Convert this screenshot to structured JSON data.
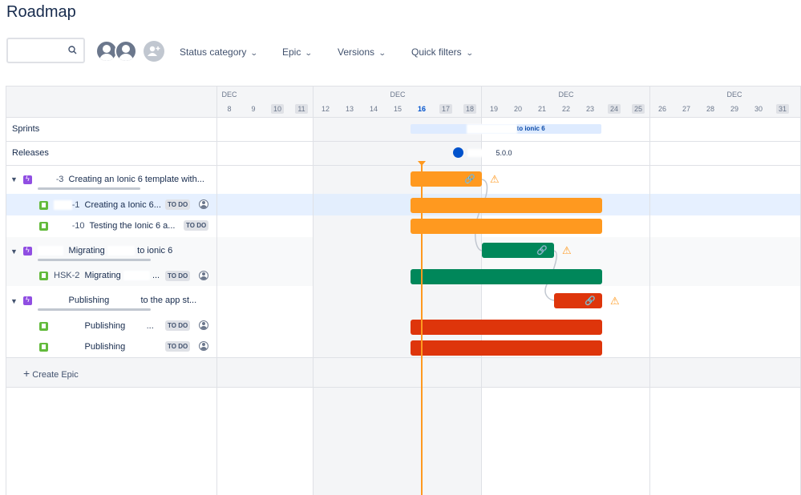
{
  "page": {
    "title": "Roadmap"
  },
  "toolbar": {
    "search_placeholder": "",
    "filters": [
      "Status category",
      "Epic",
      "Versions",
      "Quick filters"
    ]
  },
  "timeline": {
    "months": [
      "DEC",
      "DEC",
      "DEC",
      "DEC"
    ],
    "days": [
      "8",
      "9",
      "10",
      "11",
      "12",
      "13",
      "14",
      "15",
      "16",
      "17",
      "18",
      "19",
      "20",
      "21",
      "22",
      "23",
      "24",
      "25",
      "26",
      "27",
      "28",
      "29",
      "30",
      "31"
    ],
    "weekend_days": [
      "10",
      "11",
      "17",
      "18",
      "24",
      "25",
      "31"
    ],
    "today": "16"
  },
  "rows": {
    "sprints_label": "Sprints",
    "releases_label": "Releases",
    "sprint_name_visible": "to ionic 6",
    "release_version": "5.0.0",
    "create_epic": "Create Epic"
  },
  "issues": [
    {
      "type": "epic",
      "key_visible": "-3",
      "title": "Creating an Ionic 6 template with..."
    },
    {
      "type": "story",
      "key_visible": "-1",
      "title": "Creating a Ionic 6...",
      "status": "TO DO"
    },
    {
      "type": "story",
      "key_visible": "-10",
      "title": "Testing the Ionic 6 a...",
      "status": "TO DO"
    },
    {
      "type": "epic",
      "key_visible": "",
      "title_start": "Migrating",
      "title_end": "to ionic 6"
    },
    {
      "type": "story",
      "key_visible": "HSK-2",
      "title": "Migrating",
      "title_end": "...",
      "status": "TO DO"
    },
    {
      "type": "epic",
      "key_visible": "",
      "title_start": "Publishing",
      "title_end": "to the app st..."
    },
    {
      "type": "story",
      "key_visible": "",
      "title": "Publishing",
      "title_end": "...",
      "status": "TO DO"
    },
    {
      "type": "story",
      "key_visible": "",
      "title": "Publishing",
      "status": "TO DO"
    }
  ],
  "colors": {
    "orange_bar": "#ff991f",
    "green_bar": "#00875a",
    "red_bar": "#de350b",
    "today_line": "#ff991f",
    "sprint_bar": "#deebff",
    "release_dot": "#0052cc"
  }
}
